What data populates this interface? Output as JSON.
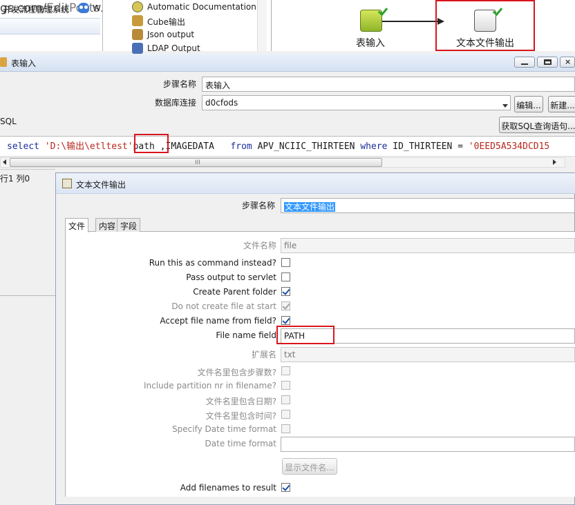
{
  "browser": {
    "url_main": "gs.com/",
    "url_rest": "EditPosts.a",
    "bookmark_label": "开发流程管理系统",
    "bookmark_extra": "W"
  },
  "step_tree": {
    "items": [
      {
        "label": "Automatic Documentation",
        "icon": "auto-doc-icon"
      },
      {
        "label": "Cube输出",
        "icon": "cube-output-icon"
      },
      {
        "label": "Json output",
        "icon": "json-output-icon"
      },
      {
        "label": "LDAP Output",
        "icon": "ldap-output-icon"
      }
    ]
  },
  "canvas": {
    "nodes": [
      {
        "label": "表输入",
        "icon": "table-input-icon"
      },
      {
        "label": "文本文件输出",
        "icon": "text-file-output-icon"
      }
    ]
  },
  "table_input_dialog": {
    "title": "表输入",
    "step_name_label": "步骤名称",
    "step_name_value": "表输入",
    "db_conn_label": "数据库连接",
    "db_conn_value": "d0cfods",
    "edit_button": "编辑...",
    "new_button": "新建...",
    "get_sql_button": "获取SQL查询语句...",
    "sql_label": "SQL",
    "sql": {
      "select": "select",
      "str1": "'D:\\输出\\etltest'",
      "field_path": "path",
      "rest1": ",IMAGEDATA",
      "from": "from",
      "table": "APV_NCIIC_THIRTEEN",
      "where": "where",
      "field": "ID_THIRTEEN",
      "eq": "=",
      "str2": "'0EED5A534DCD15"
    },
    "scroll_grip": "III",
    "row_col": "行1 列0"
  },
  "text_output_dialog": {
    "title": "文本文件输出",
    "step_name_label": "步骤名称",
    "step_name_value": "文本文件输出",
    "tabs": [
      "文件",
      "内容",
      "字段"
    ],
    "fields": {
      "filename_label": "文件名称",
      "filename_value": "file",
      "run_command_label": "Run this as command instead?",
      "pass_servlet_label": "Pass output to servlet",
      "create_parent_label": "Create Parent folder",
      "no_create_label": "Do not create file at start",
      "accept_filename_label": "Accept file name from field?",
      "filename_field_label": "File name field",
      "filename_field_value": "PATH",
      "extension_label": "扩展名",
      "extension_value": "txt",
      "include_stepnr_label": "文件名里包含步骤数?",
      "include_partition_label": "Include partition nr in filename?",
      "include_date_label": "文件名里包含日期?",
      "include_time_label": "文件名里包含时间?",
      "specify_format_label": "Specify Date time format",
      "date_format_label": "Date time format",
      "date_format_value": "",
      "show_filename_button": "显示文件名...",
      "add_to_result_label": "Add filenames to result"
    }
  },
  "colors": {
    "highlight_box": "#d9141c",
    "keyword": "#1a2d9a",
    "string": "#b8271e",
    "selection": "#3399ff"
  }
}
